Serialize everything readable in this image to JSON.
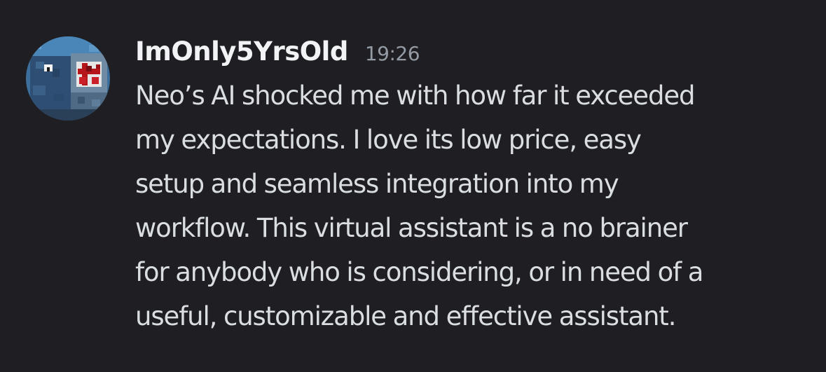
{
  "message": {
    "author": {
      "username": "ImOnly5YrsOld",
      "avatar_icon": "blocky-creature-avatar-icon"
    },
    "timestamp": "19:26",
    "lines": [
      "Neo’s AI shocked me with how far it exceeded",
      "my expectations. I love its low price, easy",
      "setup and seamless integration into my",
      "workflow. This virtual assistant is a no brainer",
      "for anybody who is considering, or in need of a",
      "useful, customizable and effective assistant."
    ]
  },
  "colors": {
    "background": "#1f1f23",
    "username": "#f2f3f5",
    "timestamp": "#949ba4",
    "body_text": "#dbdee1"
  }
}
